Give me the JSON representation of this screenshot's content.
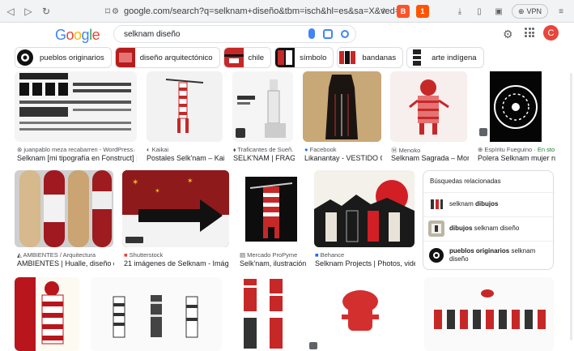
{
  "browser": {
    "url": "google.com/search?q=selknam+diseño&tbm=isch&hl=es&sa=X&ved=2ahUKEwjQtt3ahe6...",
    "vpn_label": "VPN",
    "brave_count": "1"
  },
  "google": {
    "logo": "Google",
    "query": "selknam diseño",
    "avatar_letter": "C"
  },
  "chips": [
    {
      "label": "pueblos originarios"
    },
    {
      "label": "diseño arquitectónico"
    },
    {
      "label": "chile"
    },
    {
      "label": "símbolo"
    },
    {
      "label": "bandanas"
    },
    {
      "label": "arte indígena"
    }
  ],
  "row1": [
    {
      "source": "juanpablo meza recabarren - WordPress.com",
      "title": "Selknam [mi tipografía en Fonstruct] | JU..."
    },
    {
      "source": "Kaikai",
      "title": "Postales Selk'nam – Kaik..."
    },
    {
      "source": "Traficantes de Sueñ...",
      "title": "SELK'NAM | FRAGM..."
    },
    {
      "source": "Facebook",
      "title": "Likanantay - VESTIDO CO..."
    },
    {
      "source": "Menoko",
      "title": "Selknam Sagrada – Mon..."
    },
    {
      "source": "Espíritu Fueguino",
      "stock": "· En stock",
      "title": "Polera Selknam mujer ru..."
    }
  ],
  "row2": [
    {
      "source": "AMBIENTES / Arquitectura",
      "title": "AMBIENTES | Hualle, diseño des..."
    },
    {
      "source": "Shutterstock",
      "title": "21 imágenes de Selknam - Imágene..."
    },
    {
      "source": "Mercado ProPyme",
      "title": "Selk'nam, ilustración ..."
    },
    {
      "source": "Behance",
      "title": "Selknam Projects | Photos, video..."
    }
  ],
  "related": {
    "heading": "Búsquedas relacionadas",
    "items": [
      {
        "strong": "dibujos",
        "prefix": "selknam ",
        "suffix": ""
      },
      {
        "strong": "dibujos",
        "prefix": "",
        "suffix": " selknam diseño"
      },
      {
        "strong": "pueblos originarios",
        "prefix": "",
        "suffix": " selknam diseño"
      }
    ]
  },
  "colors": {
    "accent": "#1a73e8",
    "selknam_red": "#c0202a",
    "stock_green": "#188038"
  }
}
